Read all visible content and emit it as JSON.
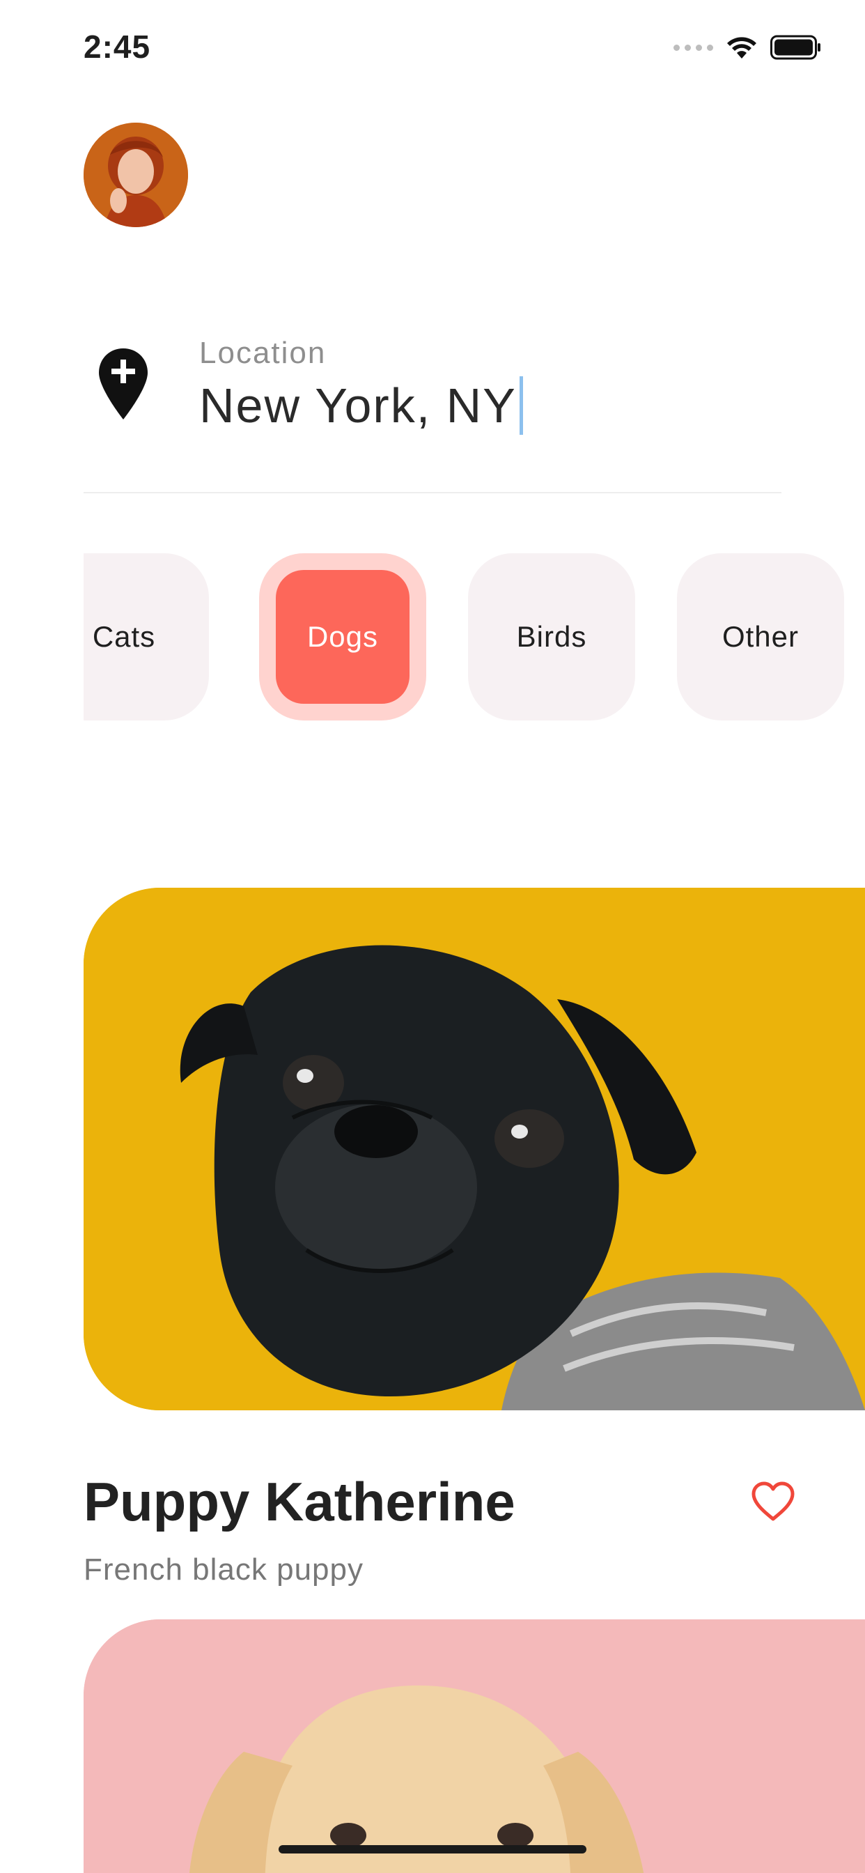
{
  "status_bar": {
    "time": "2:45"
  },
  "location": {
    "label": "Location",
    "value": "New York, NY"
  },
  "categories": [
    {
      "label": "Cats",
      "selected": false
    },
    {
      "label": "Dogs",
      "selected": true
    },
    {
      "label": "Birds",
      "selected": false
    },
    {
      "label": "Other",
      "selected": false
    }
  ],
  "pets": [
    {
      "name": "Puppy Katherine",
      "description": "French black puppy",
      "favorite_icon": "heart-outline-icon"
    }
  ],
  "colors": {
    "accent": "#fd675a",
    "accent_soft": "#ffd3cf",
    "chip_bg": "#f7f1f3",
    "card1_bg": "#ebb30b",
    "card2_bg": "#f4b9ba",
    "heart": "#f0473a"
  }
}
